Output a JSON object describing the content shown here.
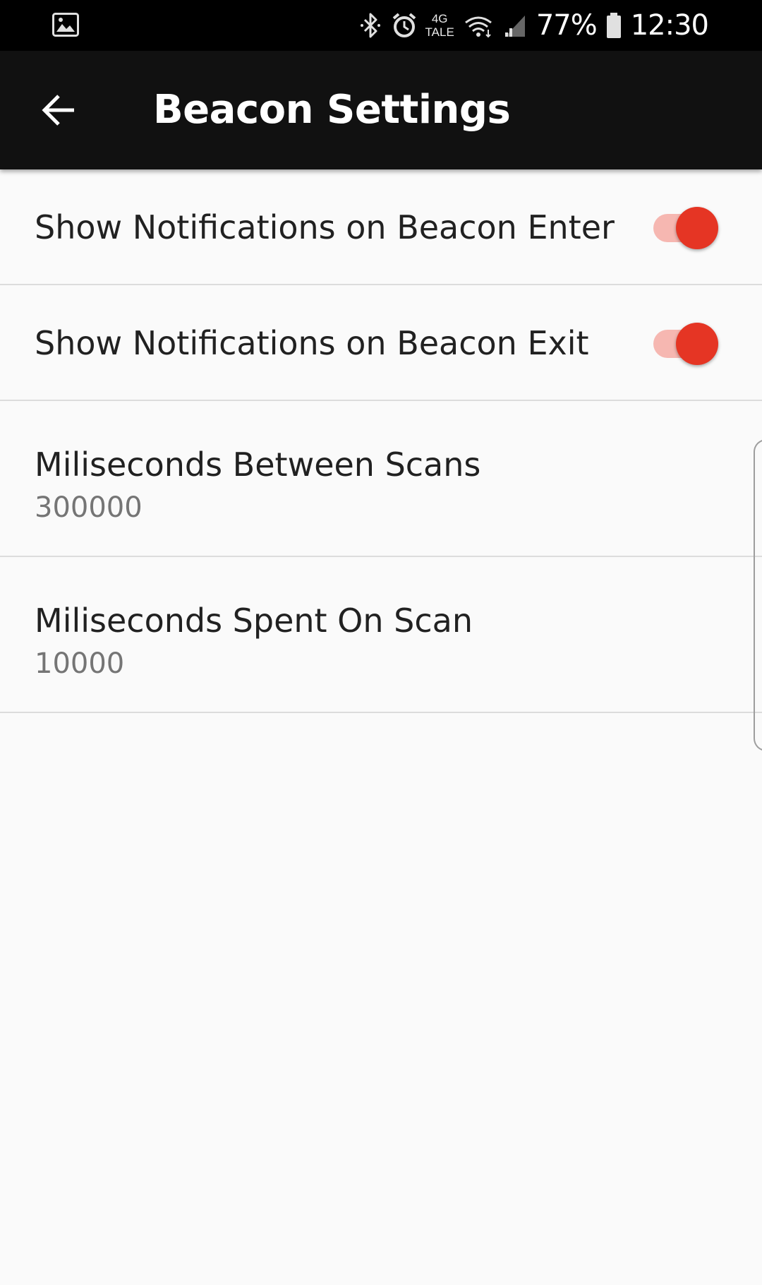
{
  "status_bar": {
    "left_icons": [
      "gallery-icon"
    ],
    "right_icons": [
      "bluetooth-icon",
      "alarm-icon",
      "wifi-icon",
      "signal-icon",
      "battery-icon"
    ],
    "network_type_top": "4G",
    "network_type_bottom": "TALE",
    "battery_percent": "77%",
    "time": "12:30"
  },
  "app_bar": {
    "back_icon": "arrow-back-icon",
    "title": "Beacon Settings",
    "background": "#111111"
  },
  "preferences": {
    "notify_enter": {
      "title": "Show Notifications on Beacon Enter",
      "checked": true
    },
    "notify_exit": {
      "title": "Show Notifications on Beacon Exit",
      "checked": true
    },
    "scan_interval": {
      "title": "Miliseconds Between Scans",
      "value": "300000"
    },
    "scan_duration": {
      "title": "Miliseconds Spent On Scan",
      "value": "10000"
    }
  },
  "colors": {
    "accent": "#e53524",
    "switch_track": "#f6b7b1",
    "background": "#fafafa",
    "divider": "#dcdcdc"
  }
}
